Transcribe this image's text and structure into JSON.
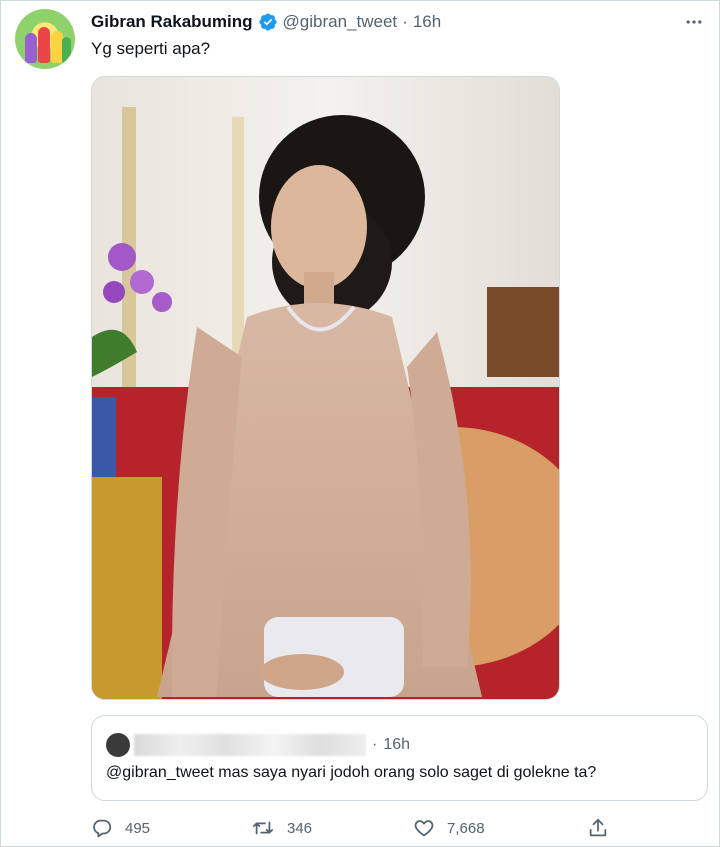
{
  "tweet": {
    "author_name": "Gibran Rakabuming",
    "handle": "@gibran_tweet",
    "separator": "·",
    "time": "16h",
    "text": "Yg seperti apa?"
  },
  "media": {
    "icon": "photo-icon"
  },
  "quote": {
    "separator": "·",
    "time": "16h",
    "text": "@gibran_tweet mas saya nyari jodoh orang solo saget di golekne ta?"
  },
  "actions": {
    "reply_count": "495",
    "retweet_count": "346",
    "like_count": "7,668"
  },
  "colors": {
    "text_primary": "#0f1419",
    "text_secondary": "#536471",
    "verified_blue": "#1d9bf0",
    "border": "#cfd9de"
  }
}
